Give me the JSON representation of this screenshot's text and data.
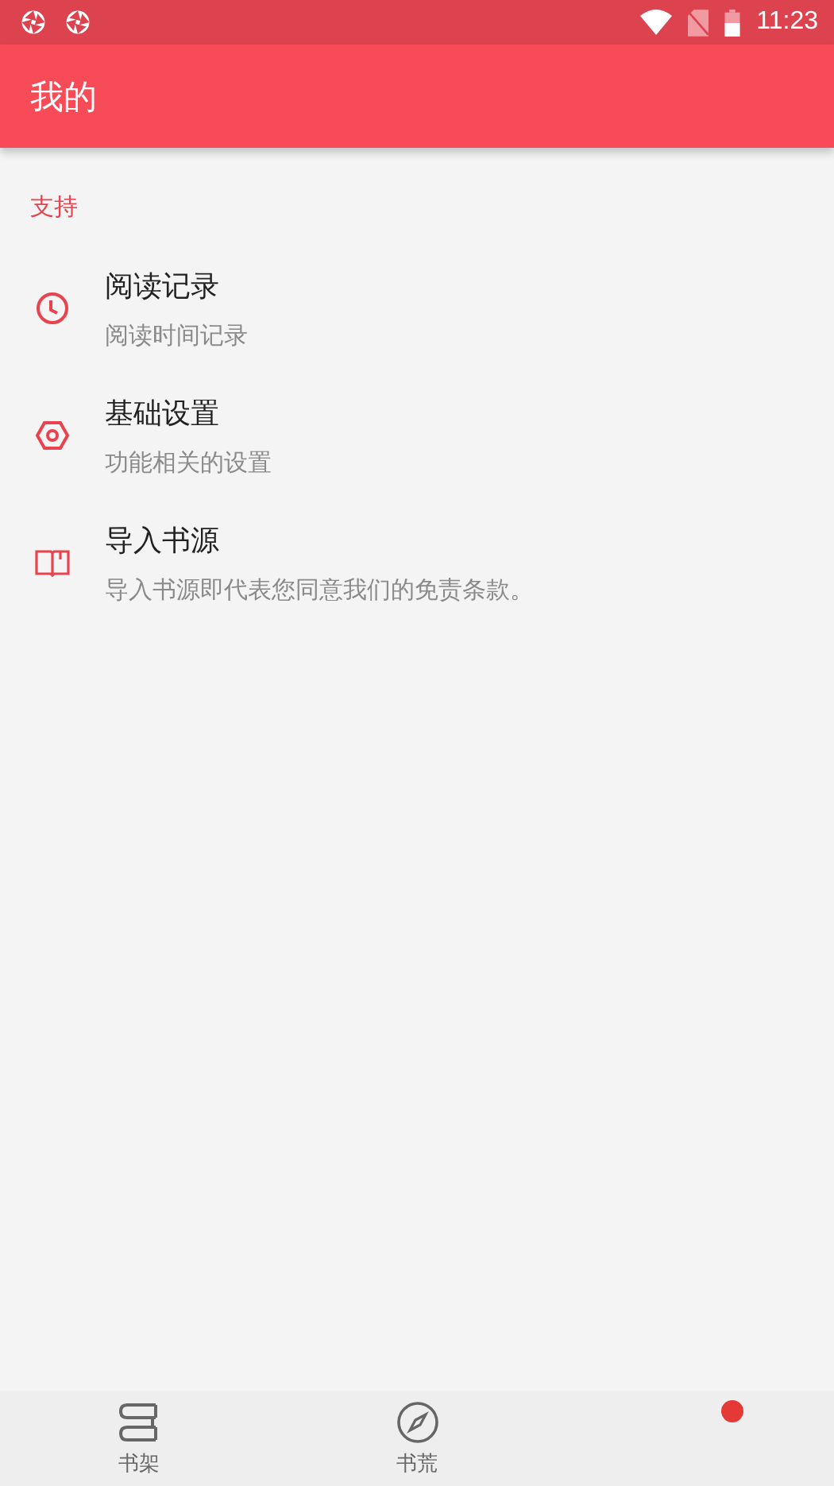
{
  "status_bar": {
    "time": "11:23"
  },
  "app_bar": {
    "title": "我的"
  },
  "section": {
    "title": "支持"
  },
  "items": [
    {
      "title": "阅读记录",
      "subtitle": "阅读时间记录"
    },
    {
      "title": "基础设置",
      "subtitle": "功能相关的设置"
    },
    {
      "title": "导入书源",
      "subtitle": "导入书源即代表您同意我们的免责条款。"
    }
  ],
  "bottom_nav": [
    {
      "label": "书架",
      "badge": false
    },
    {
      "label": "书荒",
      "badge": false
    },
    {
      "badge": true
    }
  ]
}
